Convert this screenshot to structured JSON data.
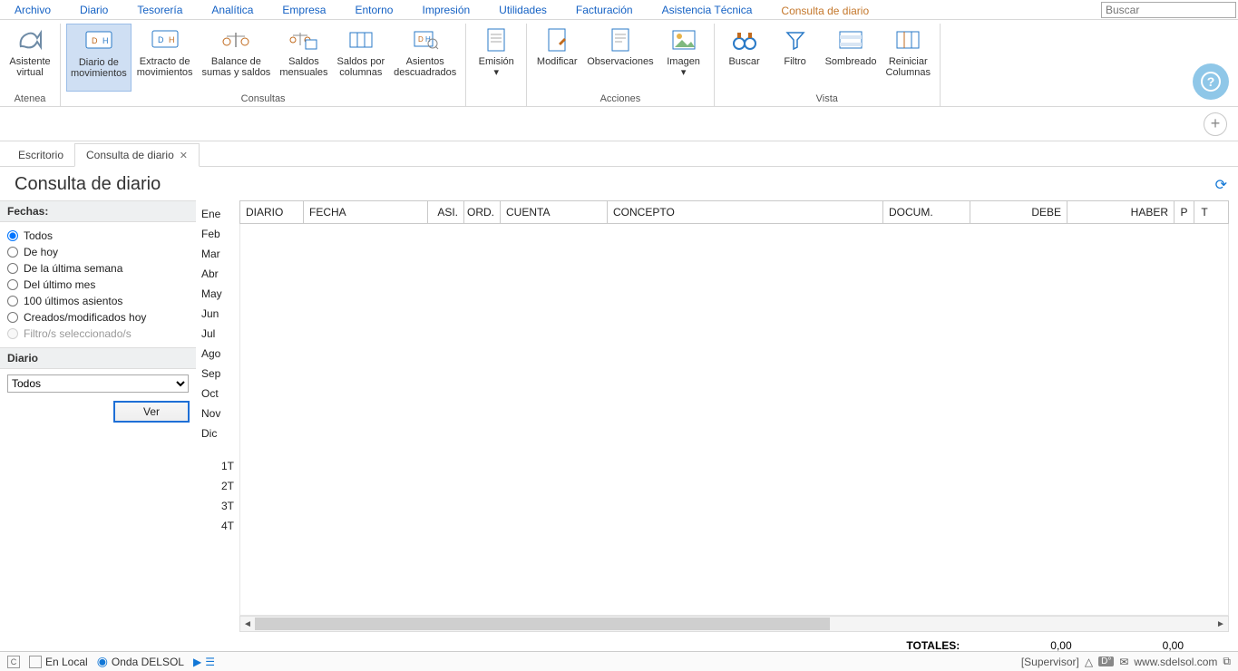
{
  "menu": {
    "items": [
      "Archivo",
      "Diario",
      "Tesorería",
      "Analítica",
      "Empresa",
      "Entorno",
      "Impresión",
      "Utilidades",
      "Facturación",
      "Asistencia Técnica",
      "Consulta de diario"
    ],
    "active_index": 10,
    "search_placeholder": "Buscar"
  },
  "ribbon": {
    "groups": [
      {
        "label": "Atenea",
        "buttons": [
          {
            "id": "asistente-virtual",
            "label": "Asistente\nvirtual"
          }
        ]
      },
      {
        "label": "Consultas",
        "buttons": [
          {
            "id": "diario-movimientos",
            "label": "Diario de\nmovimientos",
            "selected": true
          },
          {
            "id": "extracto-movimientos",
            "label": "Extracto de\nmovimientos"
          },
          {
            "id": "balance-sumas-saldos",
            "label": "Balance de\nsumas y saldos"
          },
          {
            "id": "saldos-mensuales",
            "label": "Saldos\nmensuales"
          },
          {
            "id": "saldos-por-columnas",
            "label": "Saldos por\ncolumnas"
          },
          {
            "id": "asientos-descuadrados",
            "label": "Asientos\ndescuadrados"
          }
        ]
      },
      {
        "label": "",
        "buttons": [
          {
            "id": "emision",
            "label": "Emisión\n▾"
          }
        ]
      },
      {
        "label": "Acciones",
        "buttons": [
          {
            "id": "modificar",
            "label": "Modificar"
          },
          {
            "id": "observaciones",
            "label": "Observaciones"
          },
          {
            "id": "imagen",
            "label": "Imagen\n▾"
          }
        ]
      },
      {
        "label": "Vista",
        "buttons": [
          {
            "id": "buscar",
            "label": "Buscar"
          },
          {
            "id": "filtro",
            "label": "Filtro"
          },
          {
            "id": "sombreado",
            "label": "Sombreado"
          },
          {
            "id": "reiniciar-columnas",
            "label": "Reiniciar\nColumnas\n"
          }
        ]
      }
    ]
  },
  "tabs": {
    "items": [
      {
        "label": "Escritorio",
        "closable": false
      },
      {
        "label": "Consulta de diario",
        "closable": true
      }
    ],
    "active_index": 1
  },
  "page": {
    "title": "Consulta de diario"
  },
  "filters": {
    "fechas_label": "Fechas:",
    "options": [
      {
        "label": "Todos",
        "checked": true
      },
      {
        "label": "De hoy"
      },
      {
        "label": "De la última semana"
      },
      {
        "label": "Del último mes"
      },
      {
        "label": "100 últimos asientos"
      },
      {
        "label": "Creados/modificados hoy"
      },
      {
        "label": "Filtro/s seleccionado/s",
        "disabled": true
      }
    ],
    "diario_label": "Diario",
    "diario_value": "Todos",
    "ver_label": "Ver"
  },
  "months": [
    "Ene",
    "Feb",
    "Mar",
    "Abr",
    "May",
    "Jun",
    "Jul",
    "Ago",
    "Sep",
    "Oct",
    "Nov",
    "Dic"
  ],
  "quarters": [
    "1T",
    "2T",
    "3T",
    "4T"
  ],
  "table": {
    "columns": [
      {
        "key": "diario",
        "label": "DIARIO",
        "align": "left"
      },
      {
        "key": "fecha",
        "label": "FECHA",
        "align": "left"
      },
      {
        "key": "asi",
        "label": "ASI.",
        "align": "right"
      },
      {
        "key": "ord",
        "label": "ORD.",
        "align": "right"
      },
      {
        "key": "cuenta",
        "label": "CUENTA",
        "align": "left"
      },
      {
        "key": "concepto",
        "label": "CONCEPTO",
        "align": "left"
      },
      {
        "key": "docum",
        "label": "DOCUM.",
        "align": "left"
      },
      {
        "key": "debe",
        "label": "DEBE",
        "align": "right"
      },
      {
        "key": "haber",
        "label": "HABER",
        "align": "right"
      },
      {
        "key": "p",
        "label": "P",
        "align": "center"
      },
      {
        "key": "t",
        "label": "T",
        "align": "center"
      }
    ],
    "rows": []
  },
  "totals": {
    "label": "TOTALES:",
    "debe": "0,00",
    "haber": "0,00"
  },
  "statusbar": {
    "left_items": [
      "En Local",
      "Onda DELSOL"
    ],
    "right_user": "[Supervisor]",
    "right_url": "www.sdelsol.com"
  }
}
